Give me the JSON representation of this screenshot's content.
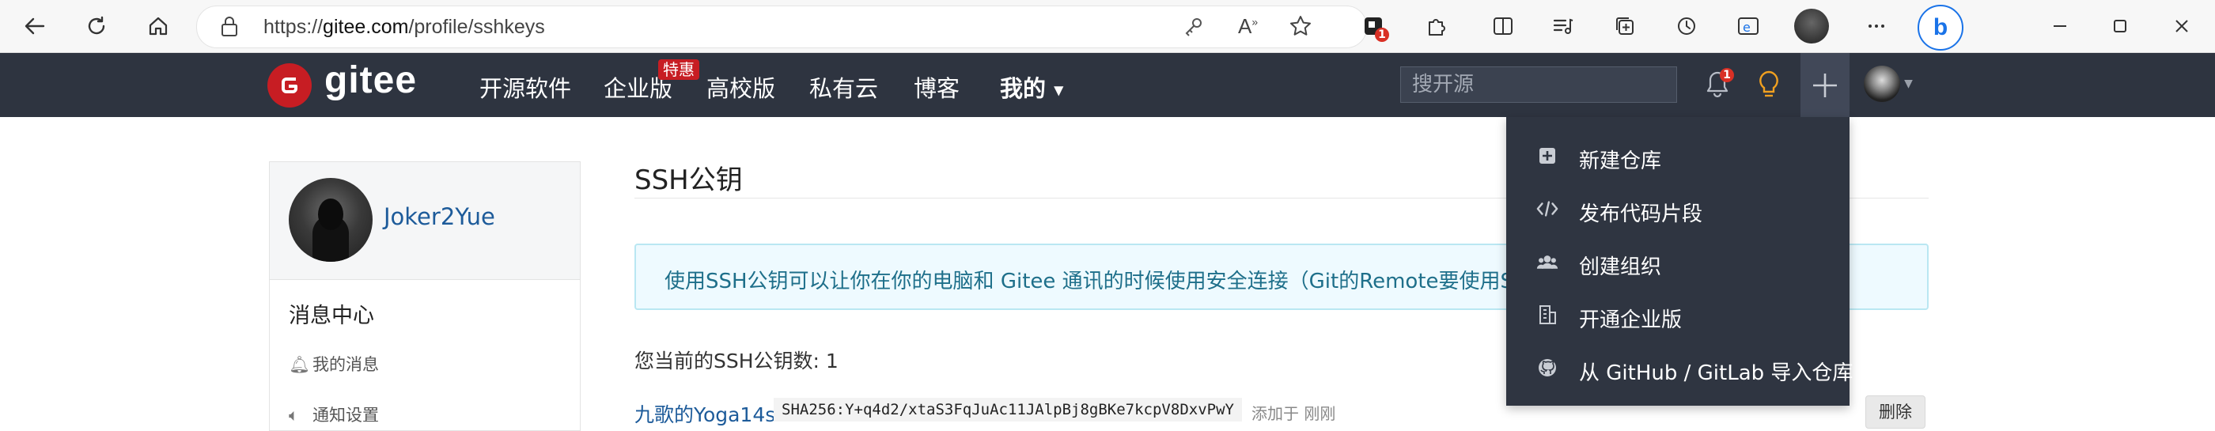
{
  "browser": {
    "url_prefix": "https://",
    "url_host": "gitee.com",
    "url_path": "/profile/sshkeys",
    "notification_count": "1"
  },
  "site": {
    "logo_text": "gitee",
    "nav": [
      "开源软件",
      "企业版",
      "高校版",
      "私有云",
      "博客",
      "我的"
    ],
    "hot_badge": "特惠",
    "search_placeholder": "搜开源",
    "bell_count": "1"
  },
  "sidebar": {
    "username": "Joker2Yue",
    "section_title": "消息中心",
    "items": [
      "我的消息",
      "通知设置"
    ]
  },
  "main": {
    "title": "SSH公钥",
    "info": "使用SSH公钥可以让你在你的电脑和 Gitee 通讯的时候使用安全连接（Git的Remote要使用SSH地址）",
    "count_text": "您当前的SSH公钥数: 1",
    "keys": [
      {
        "name": "九歌的Yoga14s",
        "fingerprint": "SHA256:Y+q4d2/xtaS3FqJuAc11JAlpBj8gBKe7kcpV8DxvPwY",
        "added": "添加于 刚刚",
        "delete_label": "删除"
      }
    ]
  },
  "dropdown": {
    "items": [
      {
        "label": "新建仓库",
        "icon": "plus-square-icon"
      },
      {
        "label": "发布代码片段",
        "icon": "code-icon"
      },
      {
        "label": "创建组织",
        "icon": "users-icon"
      },
      {
        "label": "开通企业版",
        "icon": "building-icon"
      },
      {
        "label": "从 GitHub / GitLab 导入仓库",
        "icon": "github-icon"
      }
    ]
  }
}
